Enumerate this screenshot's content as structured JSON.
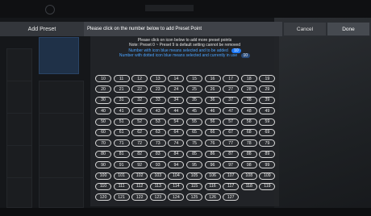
{
  "toolbar": {
    "add_preset_label": "Add Preset",
    "instruction": "Please click on the number below to add Preset Point",
    "cancel_label": "Cancel",
    "done_label": "Done"
  },
  "info": {
    "line1": "Please click on icon below to add more preset points",
    "line2": "Note: Preset 0 ~ Preset 9 is default setting cannot be removed",
    "line3": "Number with icon blue means selected and to be added",
    "line3_badge": "10",
    "line4": "Number with dotted icon blue means selected and currently in use",
    "line4_badge": "10"
  },
  "presets": [
    [
      "10",
      "11",
      "12",
      "13",
      "14",
      "15",
      "16",
      "17",
      "18",
      "19"
    ],
    [
      "20",
      "21",
      "22",
      "23",
      "24",
      "25",
      "26",
      "27",
      "28",
      "29"
    ],
    [
      "30",
      "31",
      "32",
      "33",
      "34",
      "35",
      "36",
      "37",
      "38",
      "39"
    ],
    [
      "40",
      "41",
      "42",
      "43",
      "44",
      "45",
      "46",
      "47",
      "48",
      "49"
    ],
    [
      "50",
      "51",
      "52",
      "53",
      "54",
      "55",
      "56",
      "57",
      "58",
      "59"
    ],
    [
      "60",
      "61",
      "62",
      "63",
      "64",
      "65",
      "66",
      "67",
      "68",
      "69"
    ],
    [
      "70",
      "71",
      "72",
      "73",
      "74",
      "75",
      "76",
      "77",
      "78",
      "79"
    ],
    [
      "80",
      "81",
      "82",
      "83",
      "84",
      "85",
      "86",
      "87",
      "88",
      "89"
    ],
    [
      "90",
      "91",
      "92",
      "93",
      "94",
      "95",
      "96",
      "97",
      "98",
      "99"
    ],
    [
      "100",
      "101",
      "102",
      "103",
      "104",
      "105",
      "106",
      "107",
      "108",
      "109"
    ],
    [
      "110",
      "111",
      "112",
      "113",
      "114",
      "115",
      "116",
      "117",
      "118",
      "119"
    ],
    [
      "120",
      "121",
      "122",
      "123",
      "124",
      "125",
      "126",
      "127",
      "",
      ""
    ]
  ]
}
